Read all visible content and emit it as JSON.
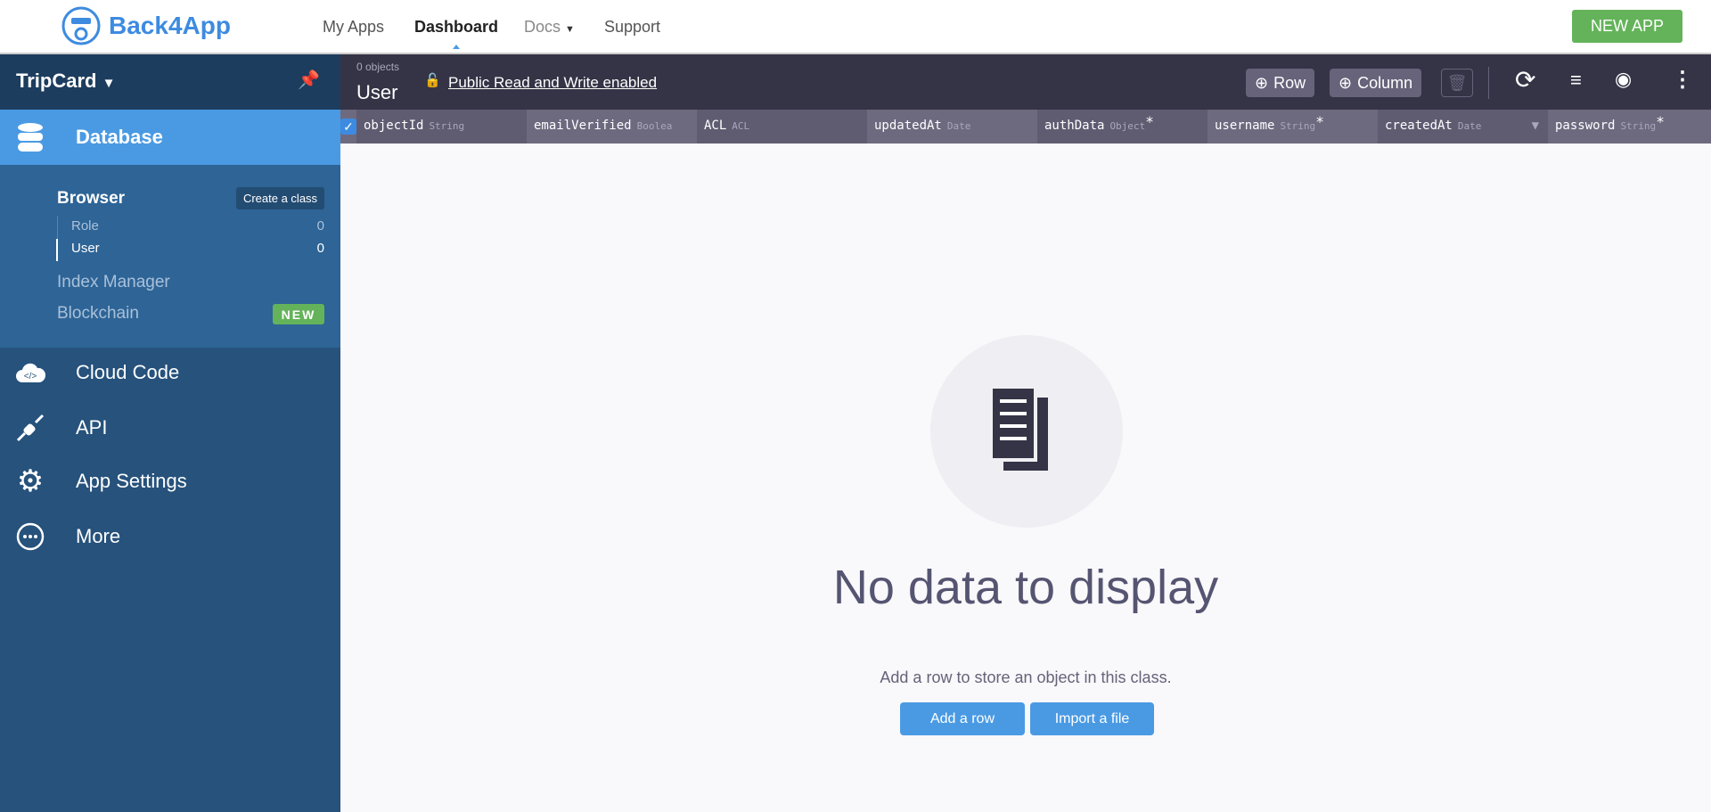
{
  "header": {
    "logo_text": "Back4App",
    "nav": [
      "My Apps",
      "Dashboard",
      "Docs",
      "Support"
    ],
    "new_app": "NEW APP"
  },
  "sidebar": {
    "app_name": "TripCard",
    "database": "Database",
    "browser": "Browser",
    "create_class": "Create a class",
    "classes": [
      {
        "name": "Role",
        "count": "0"
      },
      {
        "name": "User",
        "count": "0"
      }
    ],
    "index_manager": "Index Manager",
    "blockchain": "Blockchain",
    "new_badge": "NEW",
    "items": [
      "Cloud Code",
      "API",
      "App Settings",
      "More"
    ]
  },
  "toolbar": {
    "count": "0 objects",
    "class_name": "User",
    "acl_link": "Public Read and Write enabled",
    "row": "Row",
    "column": "Column"
  },
  "columns": [
    {
      "name": "objectId",
      "type": "String",
      "req": ""
    },
    {
      "name": "emailVerified",
      "type": "Boolea",
      "req": ""
    },
    {
      "name": "ACL",
      "type": "ACL",
      "req": ""
    },
    {
      "name": "updatedAt",
      "type": "Date",
      "req": ""
    },
    {
      "name": "authData",
      "type": "Object",
      "req": "*"
    },
    {
      "name": "username",
      "type": "String",
      "req": "*"
    },
    {
      "name": "createdAt",
      "type": "Date",
      "req": ""
    },
    {
      "name": "password",
      "type": "String",
      "req": "*"
    }
  ],
  "empty": {
    "title": "No data to display",
    "subtitle": "Add a row to store an object in this class.",
    "add_row": "Add a row",
    "import": "Import a file"
  },
  "colors": {
    "accent": "#4a9ae3",
    "green": "#64b35a",
    "toolbar": "#353446"
  }
}
